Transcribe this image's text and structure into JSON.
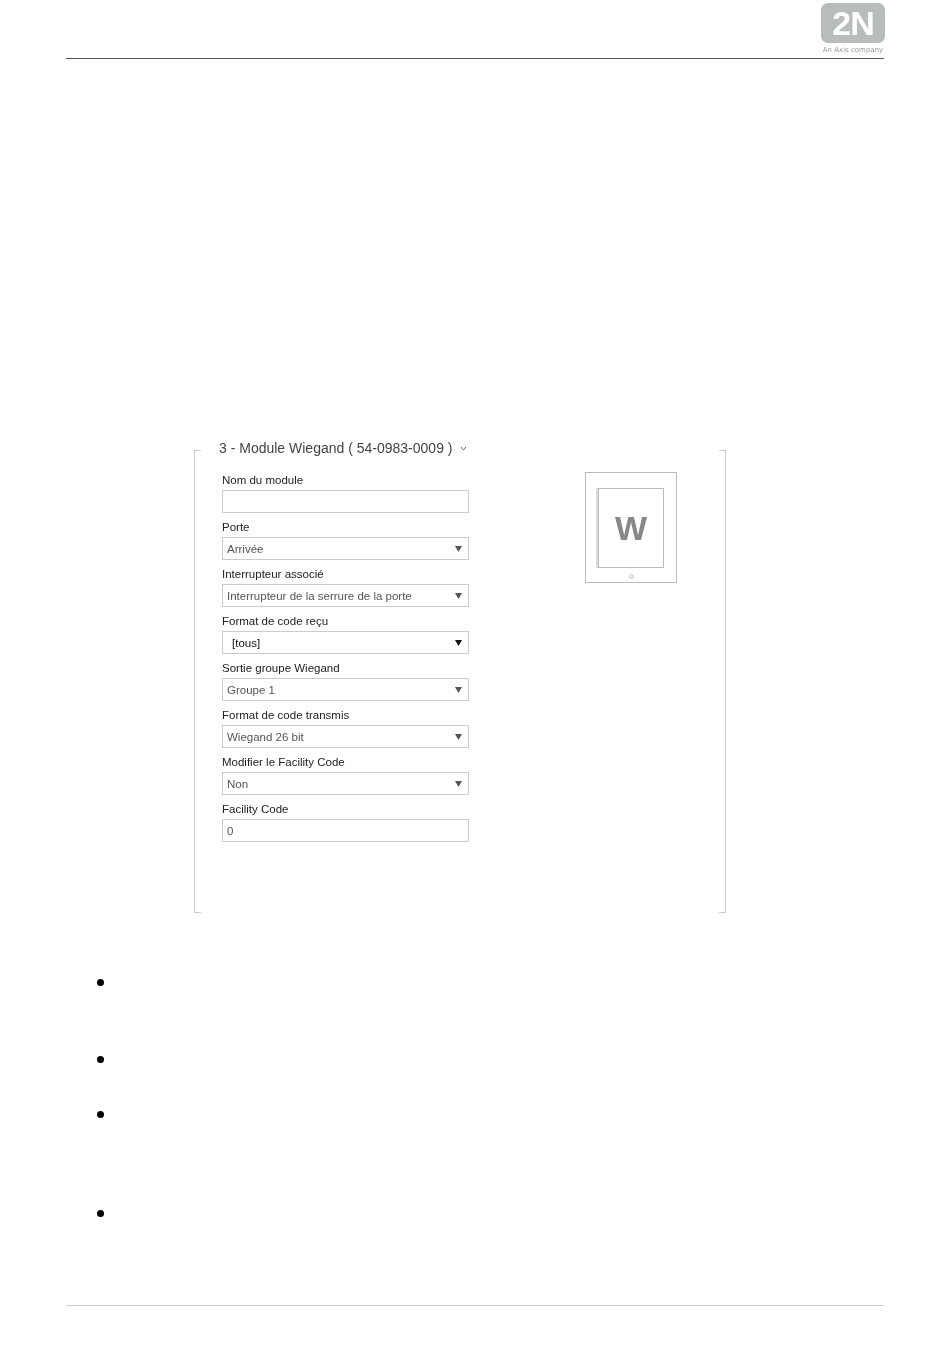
{
  "header": {
    "logo": "2N",
    "logo_tagline": "An Axis company"
  },
  "module_panel": {
    "title": "3 - Module Wiegand ( 54-0983-0009 )",
    "expanded": true,
    "device_letter": "W",
    "fields": [
      {
        "kind": "input",
        "label": "Nom du module"
      },
      {
        "kind": "select",
        "label": "Porte",
        "value": "Arrivée",
        "strong": false
      },
      {
        "kind": "select",
        "label": "Interrupteur associé",
        "value": "Interrupteur de la serrure de la porte",
        "strong": false
      },
      {
        "kind": "select",
        "label": "Format de code reçu",
        "value": "[tous]",
        "strong": true
      },
      {
        "kind": "select",
        "label": "Sortie groupe Wiegand",
        "value": "Groupe 1",
        "strong": false
      },
      {
        "kind": "select",
        "label": "Format de code transmis",
        "value": "Wiegand 26 bit",
        "strong": false
      },
      {
        "kind": "select",
        "label": "Modifier le Facility Code",
        "value": "Non",
        "strong": false
      },
      {
        "kind": "input",
        "label": "Facility Code",
        "value": "0"
      }
    ]
  },
  "bullets": [
    {
      "kind": "bullet"
    },
    {
      "kind": "bullet"
    },
    {
      "kind": "bullet"
    },
    {
      "kind": "bullet"
    }
  ]
}
